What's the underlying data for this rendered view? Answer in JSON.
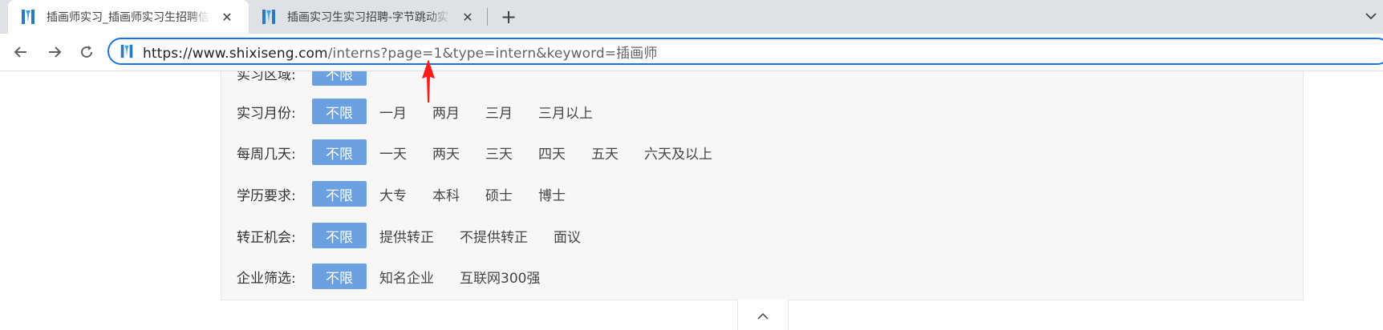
{
  "tabs": [
    {
      "title": "插画师实习_插画师实习生招聘信息",
      "close_icon": "close-icon"
    },
    {
      "title": "插画实习生实习招聘-字节跳动实习",
      "close_icon": "close-icon"
    }
  ],
  "new_tab_label": "+",
  "omnibox": {
    "url_host": "https://www.shixiseng.com",
    "url_path": "/interns?page=1&type=intern&keyword=插画师"
  },
  "filters": [
    {
      "label": "实习区域:",
      "options": [
        "不限"
      ]
    },
    {
      "label": "实习月份:",
      "options": [
        "不限",
        "一月",
        "两月",
        "三月",
        "三月以上"
      ]
    },
    {
      "label": "每周几天:",
      "options": [
        "不限",
        "一天",
        "两天",
        "三天",
        "四天",
        "五天",
        "六天及以上"
      ]
    },
    {
      "label": "学历要求:",
      "options": [
        "不限",
        "大专",
        "本科",
        "硕士",
        "博士"
      ]
    },
    {
      "label": "转正机会:",
      "options": [
        "不限",
        "提供转正",
        "不提供转正",
        "面议"
      ]
    },
    {
      "label": "企业筛选:",
      "options": [
        "不限",
        "知名企业",
        "互联网300强"
      ]
    }
  ],
  "colors": {
    "selected_option_bg": "#6ba1e0",
    "omnibox_border": "#1a73e8",
    "annotation_arrow": "#ff1a1a"
  }
}
